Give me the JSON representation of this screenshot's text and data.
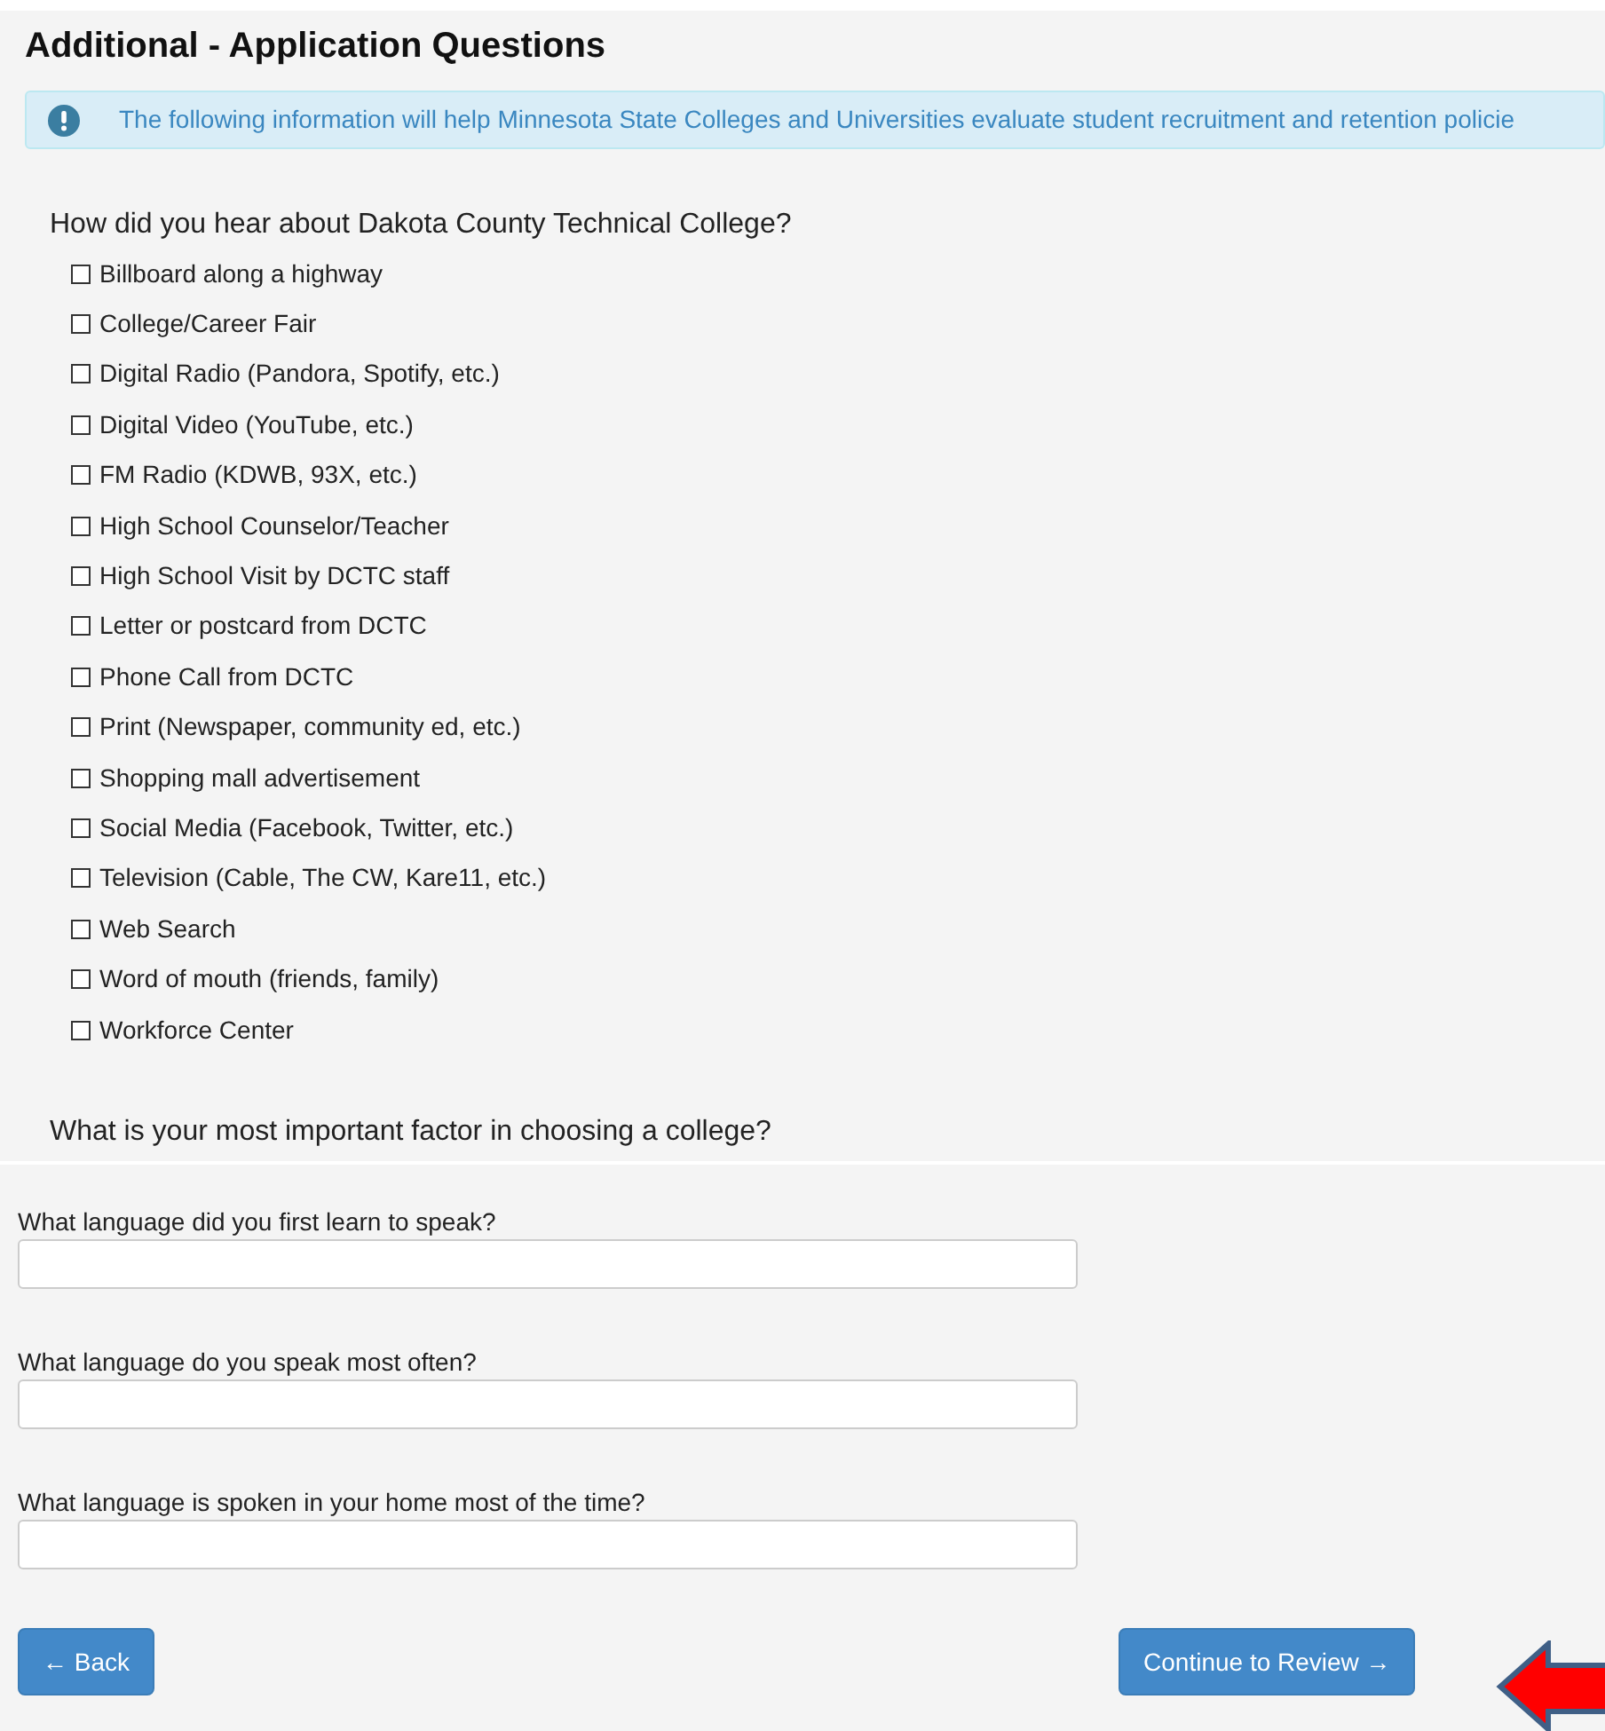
{
  "title": "Additional - Application Questions",
  "notice": "The following information will help Minnesota State Colleges and Universities evaluate student recruitment and retention policie",
  "question_1": {
    "label": "How did you hear about Dakota County Technical College?",
    "options": [
      {
        "label": "Billboard along a highway",
        "checked": false
      },
      {
        "label": "College/Career Fair",
        "checked": false
      },
      {
        "label": "Digital Radio (Pandora, Spotify, etc.)",
        "checked": false
      },
      {
        "label": "Digital Video (YouTube, etc.)",
        "checked": false
      },
      {
        "label": "FM Radio (KDWB, 93X, etc.)",
        "checked": false
      },
      {
        "label": "High School Counselor/Teacher",
        "checked": false
      },
      {
        "label": "High School Visit by DCTC staff",
        "checked": false
      },
      {
        "label": "Letter or postcard from DCTC",
        "checked": false
      },
      {
        "label": "Phone Call from DCTC",
        "checked": false
      },
      {
        "label": "Print (Newspaper, community ed, etc.)",
        "checked": false
      },
      {
        "label": "Shopping mall advertisement",
        "checked": false
      },
      {
        "label": "Social Media (Facebook, Twitter, etc.)",
        "checked": false
      },
      {
        "label": "Television (Cable, The CW, Kare11, etc.)",
        "checked": false
      },
      {
        "label": "Web Search",
        "checked": false
      },
      {
        "label": "Word of mouth (friends, family)",
        "checked": false
      },
      {
        "label": "Workforce Center",
        "checked": false
      }
    ]
  },
  "question_2": {
    "label": "What is your most important factor in choosing a college?"
  },
  "language_fields": [
    {
      "label": "What language did you first learn to speak?"
    },
    {
      "label": "What language do you speak most often?"
    },
    {
      "label": "What language is spoken in your home most of the time?"
    }
  ],
  "buttons": {
    "back": "← Back",
    "continue": "Continue to Review →"
  }
}
